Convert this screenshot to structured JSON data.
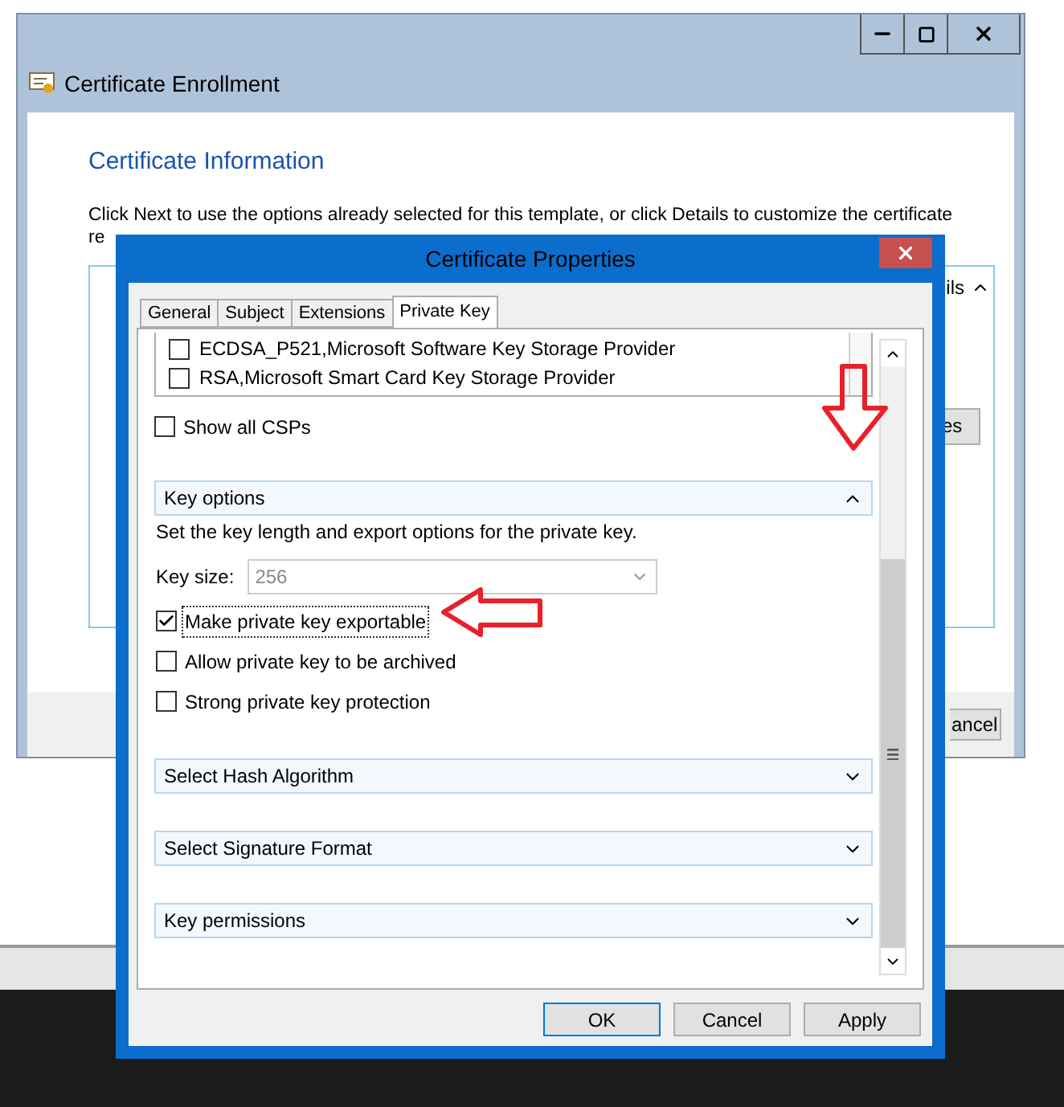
{
  "main_window": {
    "title": "Certificate Enrollment",
    "heading": "Certificate Information",
    "instruction": "Click Next to use the options already selected for this template, or click Details to customize the certificate",
    "instruction_cut": "re",
    "details_link": "ils",
    "side_button": "es",
    "cancel_button": "ancel"
  },
  "dialog": {
    "title": "Certificate Properties",
    "tabs": [
      {
        "label": "General",
        "selected": false
      },
      {
        "label": "Subject",
        "selected": false
      },
      {
        "label": "Extensions",
        "selected": false
      },
      {
        "label": "Private Key",
        "selected": true
      }
    ],
    "csp_list": [
      {
        "label": "ECDSA_P521,Microsoft Software Key Storage Provider",
        "checked": false
      },
      {
        "label": "RSA,Microsoft Smart Card Key Storage Provider",
        "checked": false
      }
    ],
    "show_all_csps": {
      "label": "Show all CSPs",
      "checked": false
    },
    "sections": [
      {
        "title": "Key options",
        "expanded": true,
        "description": "Set the key length and export options for the private key.",
        "key_size_label": "Key size:",
        "key_size": "256",
        "options": [
          {
            "label": "Make private key exportable",
            "checked": true
          },
          {
            "label": "Allow private key to be archived",
            "checked": false
          },
          {
            "label": "Strong private key protection",
            "checked": false
          }
        ]
      },
      {
        "title": "Select Hash Algorithm",
        "expanded": false
      },
      {
        "title": "Select Signature Format",
        "expanded": false
      },
      {
        "title": "Key permissions",
        "expanded": false
      }
    ],
    "buttons": [
      {
        "label": "OK",
        "kind": "default"
      },
      {
        "label": "Cancel",
        "kind": "normal"
      },
      {
        "label": "Apply",
        "kind": "normal"
      }
    ]
  }
}
